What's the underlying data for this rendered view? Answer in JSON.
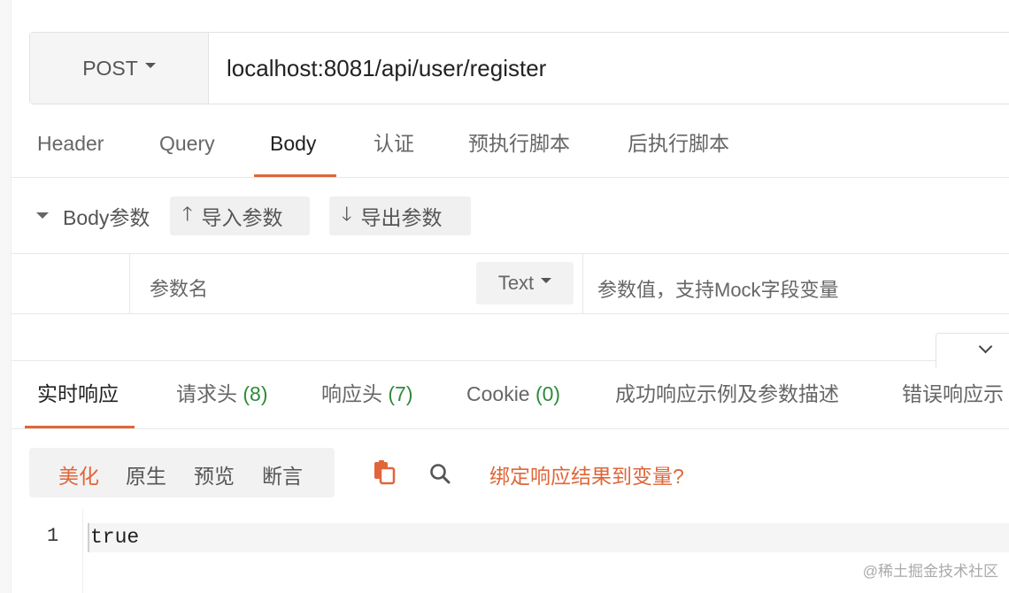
{
  "request": {
    "method": "POST",
    "url": "localhost:8081/api/user/register"
  },
  "request_tabs": [
    "Header",
    "Query",
    "Body",
    "认证",
    "预执行脚本",
    "后执行脚本"
  ],
  "request_tabs_active": "Body",
  "body_section": {
    "label": "Body参数",
    "import_label": "导入参数",
    "export_label": "导出参数"
  },
  "param_row": {
    "name_placeholder": "参数名",
    "type": "Text",
    "value_placeholder": "参数值，支持Mock字段变量"
  },
  "response_tabs": [
    {
      "label": "实时响应",
      "count": ""
    },
    {
      "label": "请求头 ",
      "count": "(8)"
    },
    {
      "label": "响应头 ",
      "count": "(7)"
    },
    {
      "label": "Cookie ",
      "count": "(0)"
    },
    {
      "label": "成功响应示例及参数描述",
      "count": ""
    },
    {
      "label": "错误响应示",
      "count": ""
    }
  ],
  "response_tabs_active": "实时响应",
  "view_modes": [
    "美化",
    "原生",
    "预览",
    "断言"
  ],
  "view_mode_active": "美化",
  "bind_link": "绑定响应结果到变量?",
  "code": {
    "line_number": "1",
    "content": "true"
  },
  "watermark": "@稀土掘金技术社区",
  "colors": {
    "accent": "#e0663a",
    "count_green": "#2e8b3b"
  },
  "icons": {
    "import": "arrow-up-icon",
    "export": "arrow-down-icon",
    "copy": "copy-icon",
    "search": "search-icon",
    "collapse": "chevron-down-icon"
  }
}
